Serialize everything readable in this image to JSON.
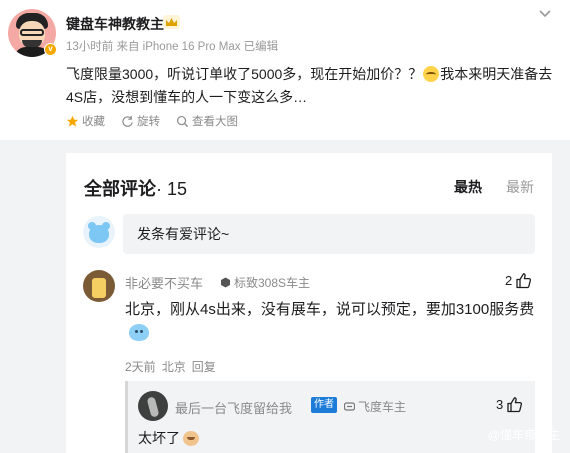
{
  "post": {
    "username": "键盘车神教教主",
    "meta": "13小时前 来自 iPhone 16 Pro Max 已编辑",
    "content_part1": "飞度限量3000，听说订单收了5000多，现在开始加价？？",
    "content_part2": "我本来明天准备去4S店，没想到懂车的人一下变这么多…",
    "actions": {
      "favorite": "收藏",
      "repost": "旋转",
      "view_image": "查看大图"
    }
  },
  "comments_section": {
    "title": "全部评论",
    "count": "· 15",
    "sort_hot": "最热",
    "sort_new": "最新",
    "input_placeholder": "发条有爱评论~"
  },
  "comment": {
    "username": "非必要不买车",
    "tag": "标致308S车主",
    "likes": "2",
    "text": "北京，刚从4s出来，没有展车，说可以预定，要加3100服务费",
    "time": "2天前",
    "location": "北京",
    "reply_label": "回复"
  },
  "reply": {
    "username": "最后一台飞度留给我",
    "author_tag": "作者",
    "tag": "飞度车主",
    "likes": "3",
    "text": "太坏了"
  },
  "watermark": "@懂车帝教主"
}
